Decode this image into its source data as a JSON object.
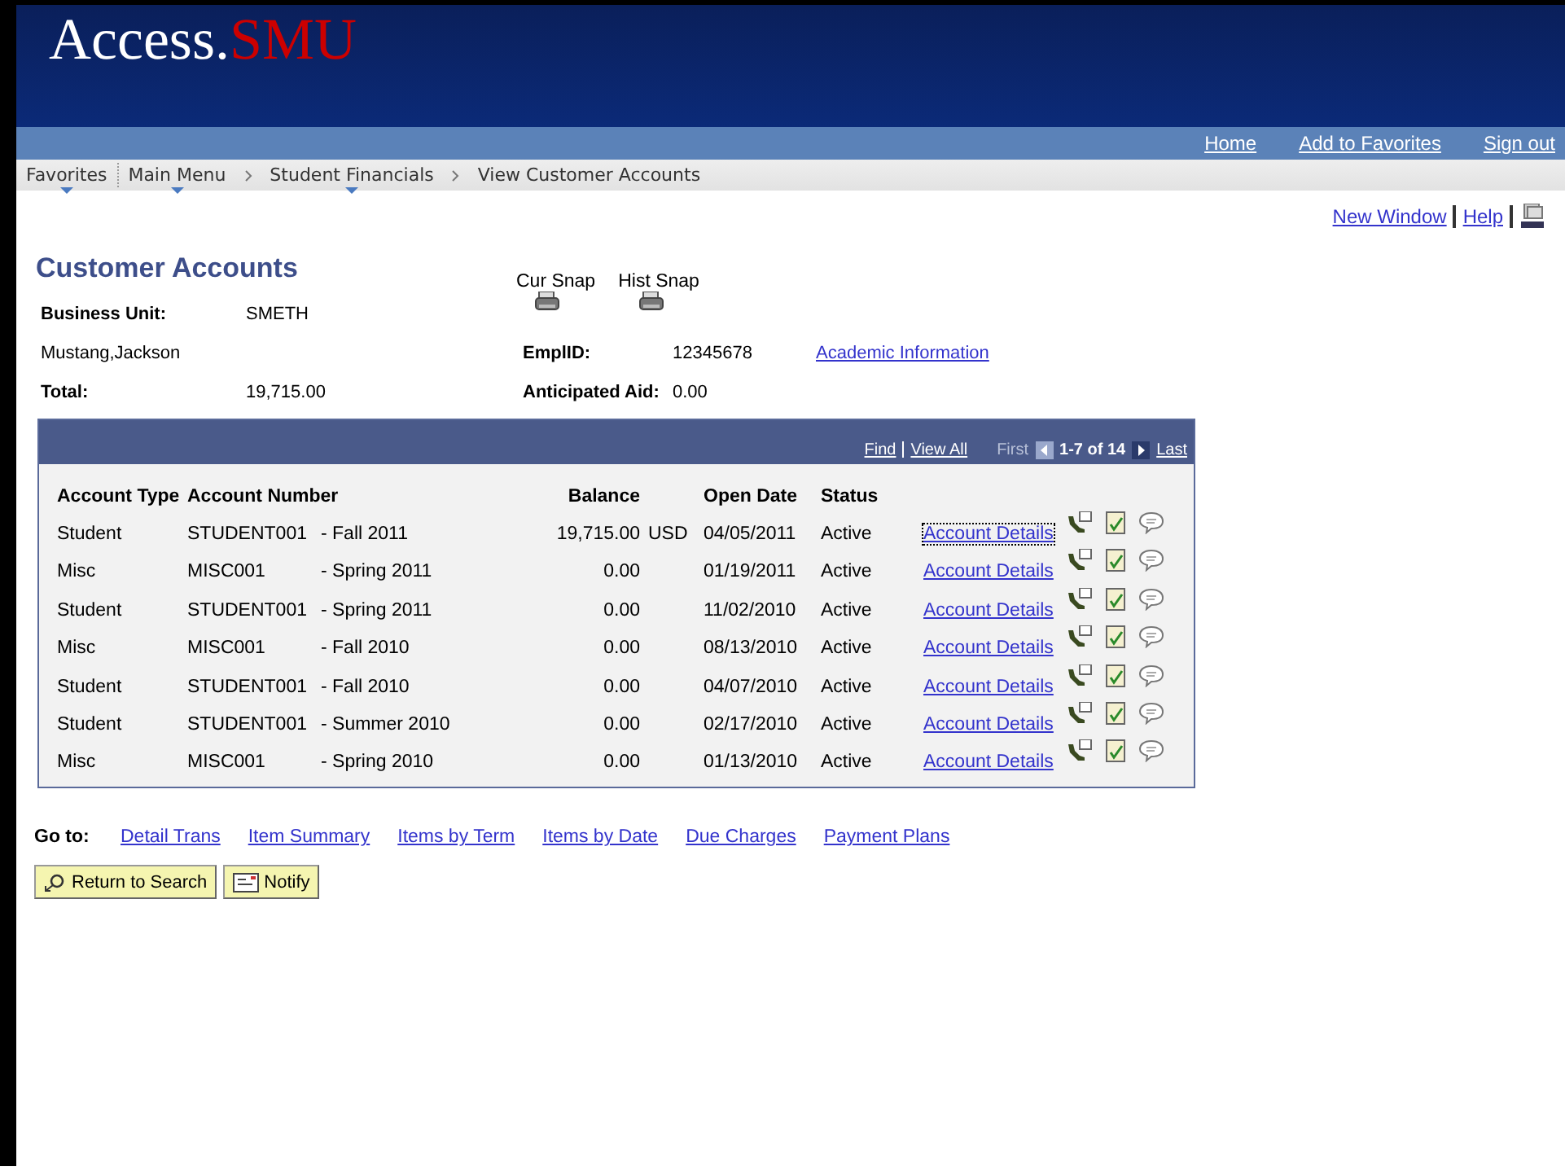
{
  "header": {
    "logo_main": "Access.",
    "logo_accent": "SMU",
    "links": [
      "Home",
      "Add to Favorites",
      "Sign out"
    ]
  },
  "breadcrumb": [
    {
      "label": "Favorites",
      "menu": true
    },
    {
      "label": "Main Menu",
      "menu": true
    },
    {
      "label": "Student Financials",
      "menu": true
    },
    {
      "label": "View Customer Accounts",
      "menu": false
    }
  ],
  "page_links": [
    "New Window",
    "Help"
  ],
  "title": "Customer Accounts",
  "snapshots": [
    "Cur Snap",
    "Hist Snap"
  ],
  "fields": {
    "business_unit_label": "Business Unit:",
    "business_unit": "SMETH",
    "name": "Mustang,Jackson",
    "emplid_label": "EmplID:",
    "emplid": "12345678",
    "academic_link": "Academic Information",
    "total_label": "Total:",
    "total": "19,715.00",
    "aid_label": "Anticipated Aid:",
    "aid": "0.00"
  },
  "grid": {
    "find": "Find",
    "view_all": "View All",
    "first": "First",
    "range": "1-7 of 14",
    "last": "Last",
    "columns": [
      "Account Type",
      "Account Number",
      "Balance",
      "Open Date",
      "Status"
    ],
    "rows": [
      {
        "type": "Student",
        "account": "STUDENT001",
        "term": "- Fall 2011",
        "balance": "19,715.00",
        "currency": "USD",
        "open_date": "04/05/2011",
        "status": "Active",
        "link": "Account Details",
        "focused": true
      },
      {
        "type": "Misc",
        "account": "MISC001",
        "term": "- Spring 2011",
        "balance": "0.00",
        "open_date": "01/19/2011",
        "status": "Active",
        "link": "Account Details",
        "focused": false
      },
      {
        "type": "Student",
        "account": "STUDENT001",
        "term": "- Spring 2011",
        "balance": "0.00",
        "open_date": "11/02/2010",
        "status": "Active",
        "link": "Account Details",
        "focused": false
      },
      {
        "type": "Misc",
        "account": "MISC001",
        "term": "- Fall 2010",
        "balance": "0.00",
        "open_date": "08/13/2010",
        "status": "Active",
        "link": "Account Details",
        "focused": false
      },
      {
        "type": "Student",
        "account": "STUDENT001",
        "term": "- Fall 2010",
        "balance": "0.00",
        "open_date": "04/07/2010",
        "status": "Active",
        "link": "Account Details",
        "focused": false
      },
      {
        "type": "Student",
        "account": "STUDENT001",
        "term": "- Summer 2010",
        "balance": "0.00",
        "open_date": "02/17/2010",
        "status": "Active",
        "link": "Account Details",
        "focused": false
      },
      {
        "type": "Misc",
        "account": "MISC001",
        "term": "- Spring 2010",
        "balance": "0.00",
        "open_date": "01/13/2010",
        "status": "Active",
        "link": "Account Details",
        "focused": false
      }
    ]
  },
  "goto": {
    "label": "Go to:",
    "links": [
      "Detail Trans",
      "Item Summary",
      "Items by Term",
      "Items by Date",
      "Due Charges",
      "Payment Plans"
    ]
  },
  "buttons": [
    "Return to Search",
    "Notify"
  ]
}
